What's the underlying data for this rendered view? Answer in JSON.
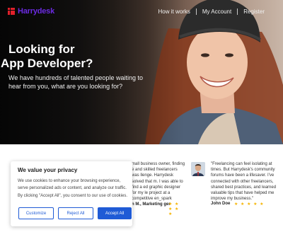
{
  "brand": {
    "name": "Harrydesk",
    "logo_color": "#e0202a",
    "text_color": "#6a2ae0"
  },
  "nav": {
    "items": [
      "How it works",
      "My Account",
      "Register"
    ]
  },
  "hero": {
    "title_line1": "Looking for",
    "title_line2": "App Developer?",
    "subtitle": "We have hundreds of talented people waiting to hear from you, what are you looking for?"
  },
  "testimonials": [
    {
      "text": "mall business owner, finding e and skilled freelancers was llenge. Harrydesk solved that m. I was able to find a ed graphic designer for my le project at a competitive en_spark",
      "author": "n M., Marketing ger",
      "stars": "★ ★ ★ ★ ★"
    },
    {
      "text": "\"Freelancing can feel isolating at times. But Harrydesk's community forums have been a lifesaver. I've connected with other freelancers, shared best practices, and learned valuable tips that have helped me improve my business.\"",
      "author": "John Doe",
      "stars": "★ ★ ★ ★ ★"
    }
  ],
  "cookie_banner": {
    "title": "We value your privacy",
    "text": "We use cookies to enhance your browsing experience, serve personalized ads or content, and analyze our traffic. By clicking \"Accept All\", you consent to our use of cookies.",
    "customize_label": "Customize",
    "reject_label": "Reject All",
    "accept_label": "Accept All",
    "accent_color": "#1f5bd6"
  },
  "icons": [
    "logo-grid-icon",
    "star-icon",
    "avatar-photo"
  ]
}
